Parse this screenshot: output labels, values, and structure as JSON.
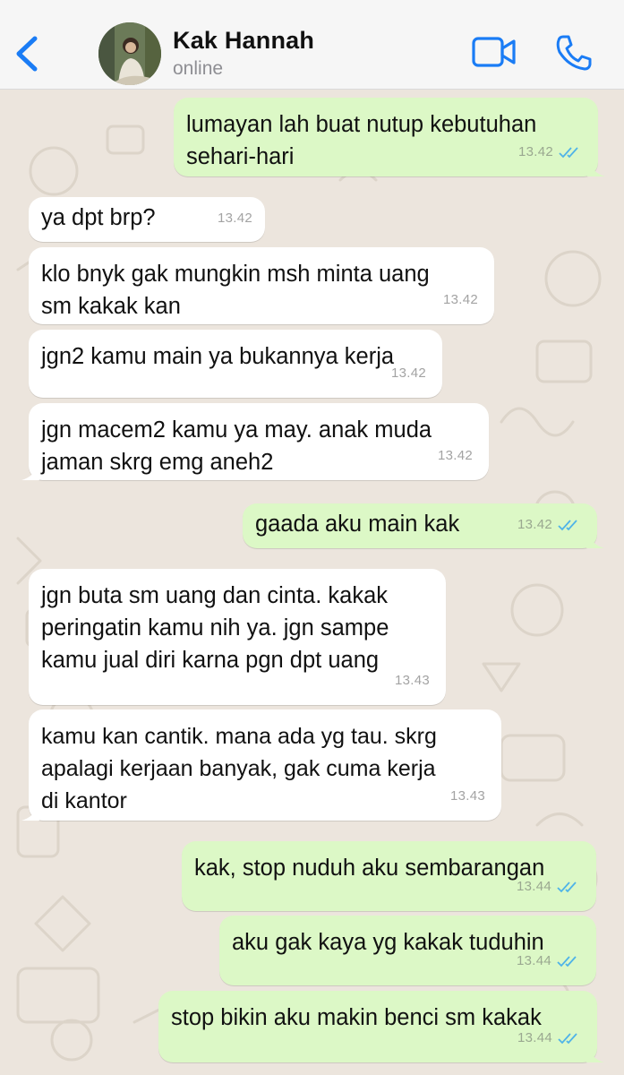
{
  "header": {
    "contact_name": "Kak Hannah",
    "status": "online"
  },
  "messages": [
    {
      "direction": "out",
      "text": "lumayan lah buat nutup kebutuhan\nsehari-hari",
      "time": "13.42",
      "read": true
    },
    {
      "direction": "in",
      "text": "ya dpt brp?",
      "time": "13.42"
    },
    {
      "direction": "in",
      "text": "klo bnyk gak mungkin msh minta uang\nsm kakak kan",
      "time": "13.42"
    },
    {
      "direction": "in",
      "text": "jgn2 kamu main ya bukannya kerja",
      "time": "13.42"
    },
    {
      "direction": "in",
      "text": "jgn macem2 kamu ya may. anak muda\njaman skrg emg aneh2",
      "time": "13.42"
    },
    {
      "direction": "out",
      "text": "gaada aku main kak",
      "time": "13.42",
      "read": true
    },
    {
      "direction": "in",
      "text": "jgn buta sm uang dan cinta. kakak\nperingatin kamu nih ya. jgn sampe\nkamu jual diri karna pgn dpt uang",
      "time": "13.43"
    },
    {
      "direction": "in",
      "text": "kamu kan cantik. mana ada yg tau. skrg\napalagi kerjaan banyak, gak cuma kerja\ndi kantor",
      "time": "13.43"
    },
    {
      "direction": "out",
      "text": "kak, stop nuduh aku sembarangan",
      "time": "13.44",
      "read": true
    },
    {
      "direction": "out",
      "text": "aku gak kaya yg kakak tuduhin",
      "time": "13.44",
      "read": true
    },
    {
      "direction": "out",
      "text": "stop bikin aku makin benci sm kakak",
      "time": "13.44",
      "read": true
    }
  ],
  "colors": {
    "accent": "#1a7cf5",
    "incoming_bubble": "#ffffff",
    "outgoing_bubble": "#dcf8c6",
    "wallpaper": "#ece5dd",
    "read_ticks": "#4fb3e8"
  }
}
